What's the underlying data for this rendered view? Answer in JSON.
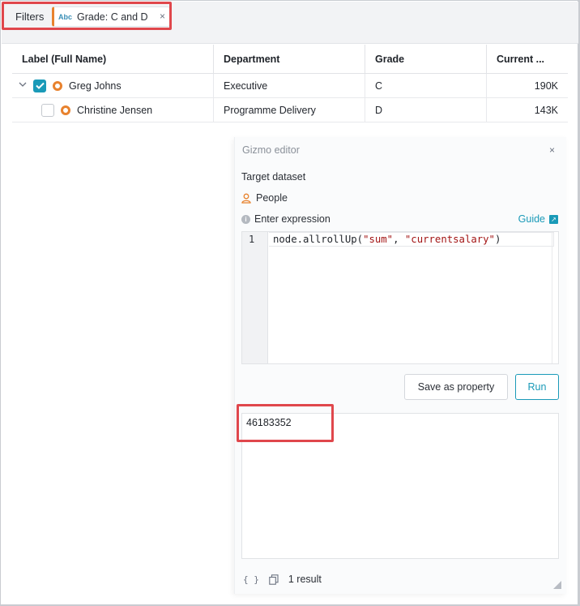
{
  "filters": {
    "label": "Filters",
    "chip": {
      "type_label": "Abc",
      "text": "Grade: C and D",
      "close": "×"
    }
  },
  "table": {
    "columns": [
      "Label (Full Name)",
      "Department",
      "Grade",
      "Current ..."
    ],
    "rows": [
      {
        "name": "Greg Johns",
        "department": "Executive",
        "grade": "C",
        "current": "190K",
        "expanded": true,
        "checked": true
      },
      {
        "name": "Christine Jensen",
        "department": "Programme Delivery",
        "grade": "D",
        "current": "143K",
        "expanded": false,
        "checked": false
      }
    ]
  },
  "gizmo": {
    "title": "Gizmo editor",
    "close": "×",
    "target_label": "Target dataset",
    "dataset": "People",
    "expression_label": "Enter expression",
    "guide_label": "Guide",
    "line_number": "1",
    "code_prefix": "node.allrollUp(",
    "code_arg1": "\"sum\"",
    "code_sep": ", ",
    "code_arg2": "\"currentsalary\"",
    "code_suffix": ")",
    "save_label": "Save as property",
    "run_label": "Run",
    "result_value": "46183352",
    "result_count": "1 result"
  },
  "colors": {
    "accent": "#1a9ab8",
    "node": "#e8822e",
    "highlight": "#e0474c"
  }
}
